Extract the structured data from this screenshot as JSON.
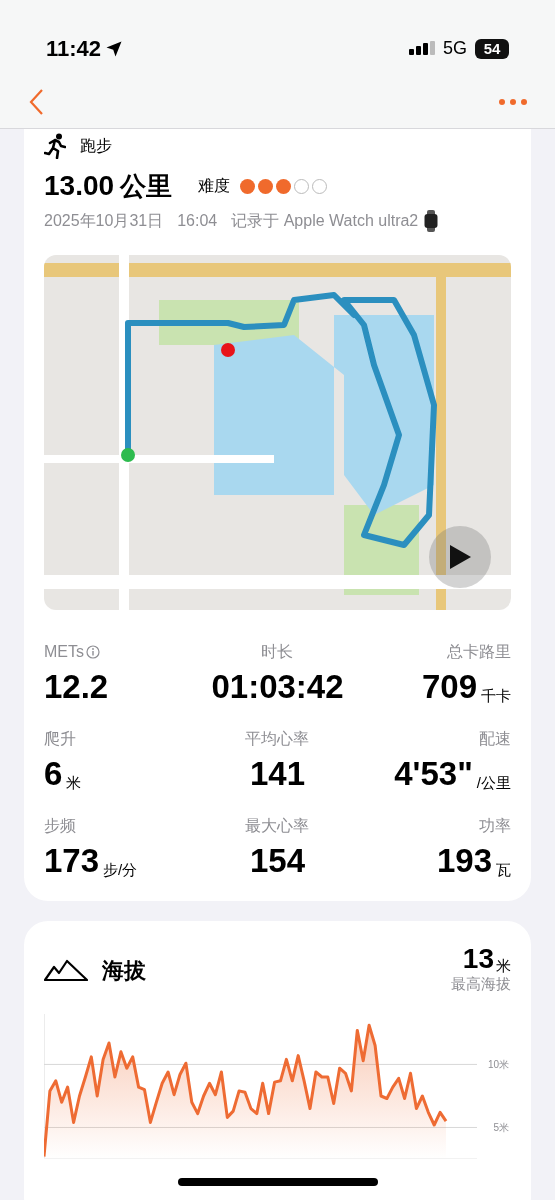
{
  "status_bar": {
    "time": "11:42",
    "network": "5G",
    "battery": "54"
  },
  "workout": {
    "type": "跑步",
    "distance": "13.00",
    "distance_unit": "公里",
    "difficulty_label": "难度",
    "difficulty": {
      "stars": 3
    },
    "date": "2025年10月31日",
    "time": "16:04",
    "source": "记录于 Apple Watch ultra2"
  },
  "stats": [
    {
      "label": "METs",
      "info": true,
      "value": "12.2"
    },
    {
      "label": "时长",
      "info": false,
      "value": "01:03:42"
    },
    {
      "label": "总卡路里",
      "info": false,
      "value": "709",
      "unit": "千卡"
    },
    {
      "label": "爬升",
      "info": false,
      "value": "6",
      "unit": "米"
    },
    {
      "label": "平均心率",
      "info": false,
      "value": "141"
    },
    {
      "label": "配速",
      "info": false,
      "value": "4'53\"",
      "unit": "/公里"
    },
    {
      "label": "步频",
      "info": false,
      "value": "173",
      "unit": "步/分"
    },
    {
      "label": "最大心率",
      "info": false,
      "value": "154"
    },
    {
      "label": "功率",
      "info": false,
      "value": "193",
      "unit": "瓦"
    }
  ],
  "elevation": {
    "title": "海拔",
    "max_value": "13",
    "max_unit": "米",
    "max_label": "最高海拔",
    "chart_data": {
      "type": "area",
      "ylim": [
        2.5,
        14
      ],
      "yticks": [
        {
          "value": 5,
          "label": "5米"
        },
        {
          "value": 10,
          "label": "10米"
        }
      ],
      "series": [
        {
          "color": "#ee6b33",
          "values": [
            2.7,
            7.9,
            8.7,
            7.0,
            8.2,
            5.4,
            7.5,
            9.0,
            10.6,
            7.5,
            10.4,
            11.7,
            9.0,
            11.0,
            9.7,
            10.6,
            8.2,
            8.0,
            5.4,
            7.0,
            8.5,
            9.4,
            7.6,
            9.2,
            10.1,
            7.0,
            6.1,
            7.5,
            8.5,
            7.6,
            9.4,
            5.8,
            6.3,
            7.9,
            7.8,
            6.5,
            6.1,
            8.5,
            6.1,
            8.6,
            8.7,
            10.4,
            8.7,
            10.7,
            8.7,
            6.5,
            9.4,
            9.0,
            9.0,
            6.9,
            9.7,
            9.3,
            7.9,
            12.7,
            10.3,
            13.1,
            11.5,
            7.5,
            7.3,
            8.2,
            8.9,
            7.3,
            9.3,
            6.5,
            7.5,
            6.2,
            5.2,
            6.2,
            5.5
          ]
        }
      ]
    }
  }
}
